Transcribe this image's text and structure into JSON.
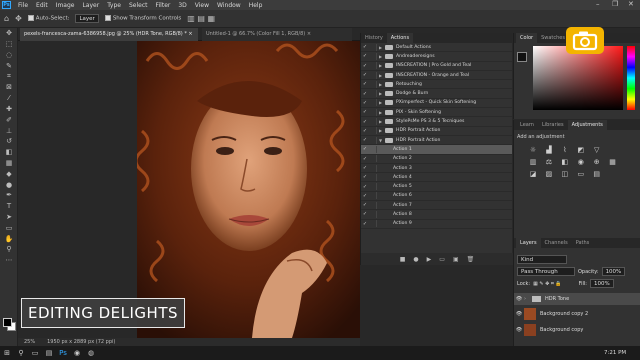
{
  "app": {
    "logo": "Ps",
    "menu": [
      "File",
      "Edit",
      "Image",
      "Layer",
      "Type",
      "Select",
      "Filter",
      "3D",
      "View",
      "Window",
      "Help"
    ],
    "window_controls": [
      "–",
      "❐",
      "✕"
    ]
  },
  "options_bar": {
    "auto_select_label": "Auto-Select:",
    "auto_select_value": "Layer",
    "show_transform_label": "Show Transform Controls"
  },
  "tabs": [
    {
      "label": "pexels-francesca-zama-6386958.jpg @ 25% (HDR Tone, RGB/8) *  ×"
    },
    {
      "label": "Untitled-1 @ 66.7% (Color Fill 1, RGB/8)  ×"
    }
  ],
  "status": {
    "zoom": "25%",
    "doc_size": "1950 px x 2889 px (72 ppi)"
  },
  "banner": {
    "text": "EDITING DELIGHTS"
  },
  "actions_panel": {
    "tabs": [
      "History",
      "Actions"
    ],
    "active_tab": "Actions",
    "rows": [
      {
        "label": "Default Actions",
        "type": "set"
      },
      {
        "label": "Andreaderesigns",
        "type": "set"
      },
      {
        "label": "INSCREATION | Pro Gold and Teal",
        "type": "set"
      },
      {
        "label": "INSCREATION - Orange and Teal",
        "type": "set"
      },
      {
        "label": "Retouching",
        "type": "set"
      },
      {
        "label": "Dodge & Burn",
        "type": "set"
      },
      {
        "label": "PXimperfect - Quick Skin Softening",
        "type": "set"
      },
      {
        "label": "PIX - Skin Softening",
        "type": "set"
      },
      {
        "label": "StylePsMe PS 3 & 5 Tecniques",
        "type": "set"
      },
      {
        "label": "HDR Portrait Action",
        "type": "set"
      },
      {
        "label": "HDR Portrait Action",
        "type": "set-open"
      },
      {
        "label": "Action 1",
        "type": "action",
        "selected": true
      },
      {
        "label": "Action 2",
        "type": "action"
      },
      {
        "label": "Action 3",
        "type": "action"
      },
      {
        "label": "Action 4",
        "type": "action"
      },
      {
        "label": "Action 5",
        "type": "action"
      },
      {
        "label": "Action 6",
        "type": "action"
      },
      {
        "label": "Action 7",
        "type": "action"
      },
      {
        "label": "Action 8",
        "type": "action"
      },
      {
        "label": "Action 9",
        "type": "action"
      }
    ],
    "footer_icons": [
      "■",
      "●",
      "▶",
      "▭",
      "▣",
      "🗑"
    ]
  },
  "color_panel": {
    "tabs": [
      "Color",
      "Swatches"
    ]
  },
  "adjustments_panel": {
    "tabs": [
      "Learn",
      "Libraries",
      "Adjustments"
    ],
    "active_tab": "Adjustments",
    "hint": "Add an adjustment"
  },
  "layers_panel": {
    "tabs": [
      "Layers",
      "Channels",
      "Paths"
    ],
    "active_tab": "Layers",
    "kind": "Kind",
    "blend_mode": "Pass Through",
    "opacity_label": "Opacity:",
    "opacity_value": "100%",
    "lock_label": "Lock:",
    "fill_label": "Fill:",
    "fill_value": "100%",
    "layers": [
      {
        "name": "HDR Tone",
        "type": "group"
      },
      {
        "name": "Background copy 2",
        "type": "image"
      },
      {
        "name": "Background copy",
        "type": "image"
      }
    ]
  },
  "taskbar": {
    "time": "7:21 PM"
  }
}
